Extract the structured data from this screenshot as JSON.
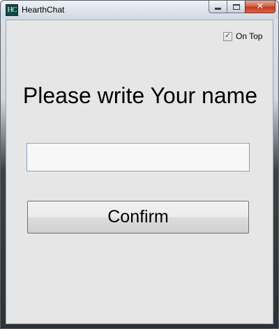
{
  "window": {
    "title": "HearthChat",
    "icon_text": "HC",
    "close_glyph": "✕"
  },
  "ontop": {
    "label": "On Top",
    "checked": true,
    "check_glyph": "✓"
  },
  "main": {
    "prompt": "Please write Your name",
    "name_value": "",
    "confirm_label": "Confirm"
  },
  "colors": {
    "client_bg": "#e6e6e6",
    "close_button": "#c0381d",
    "input_border": "#7ea6c8"
  }
}
